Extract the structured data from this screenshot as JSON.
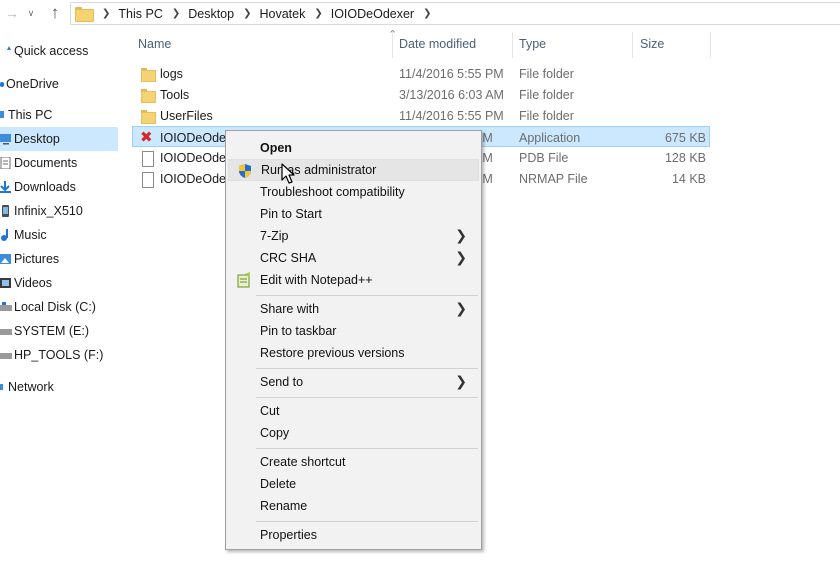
{
  "address": {
    "path": [
      "This PC",
      "Desktop",
      "Hovatek",
      "IOIODeOdexer"
    ]
  },
  "sidebar": {
    "items": [
      {
        "label": "Quick access",
        "icon": "star-icon"
      },
      {
        "label": "OneDrive",
        "icon": "cloud-icon"
      },
      {
        "label": "This PC",
        "icon": "computer-icon"
      },
      {
        "label": "Desktop",
        "icon": "desktop-icon",
        "selected": true
      },
      {
        "label": "Documents",
        "icon": "documents-icon"
      },
      {
        "label": "Downloads",
        "icon": "downloads-icon"
      },
      {
        "label": "Infinix_X510",
        "icon": "phone-icon"
      },
      {
        "label": "Music",
        "icon": "music-icon"
      },
      {
        "label": "Pictures",
        "icon": "pictures-icon"
      },
      {
        "label": "Videos",
        "icon": "videos-icon"
      },
      {
        "label": "Local Disk (C:)",
        "icon": "drive-icon"
      },
      {
        "label": "SYSTEM (E:)",
        "icon": "drive-icon"
      },
      {
        "label": "HP_TOOLS (F:)",
        "icon": "drive-icon"
      },
      {
        "label": "Network",
        "icon": "network-icon"
      }
    ]
  },
  "columns": {
    "name": "Name",
    "date": "Date modified",
    "type": "Type",
    "size": "Size"
  },
  "files": [
    {
      "name": "logs",
      "date": "11/4/2016 5:55 PM",
      "type": "File folder",
      "size": "",
      "icon": "folder-icon"
    },
    {
      "name": "Tools",
      "date": "3/13/2016 6:03 AM",
      "type": "File folder",
      "size": "",
      "icon": "folder-icon"
    },
    {
      "name": "UserFiles",
      "date": "11/4/2016 5:55 PM",
      "type": "File folder",
      "size": "",
      "icon": "folder-icon"
    },
    {
      "name": "IOIODeOdex",
      "date": "AM",
      "type": "Application",
      "size": "675 KB",
      "icon": "app-icon",
      "selected": true
    },
    {
      "name": "IOIODeOdex",
      "date": "AM",
      "type": "PDB File",
      "size": "128 KB",
      "icon": "file-icon"
    },
    {
      "name": "IOIODeOdex",
      "date": "AM",
      "type": "NRMAP File",
      "size": "14 KB",
      "icon": "file-icon"
    }
  ],
  "context_menu": {
    "items": {
      "open": "Open",
      "run_as_admin": "Run as administrator",
      "troubleshoot": "Troubleshoot compatibility",
      "pin_start": "Pin to Start",
      "seven_zip": "7-Zip",
      "crc_sha": "CRC SHA",
      "edit_notepad": "Edit with Notepad++",
      "share_with": "Share with",
      "pin_taskbar": "Pin to taskbar",
      "restore_versions": "Restore previous versions",
      "send_to": "Send to",
      "cut": "Cut",
      "copy": "Copy",
      "create_shortcut": "Create shortcut",
      "delete": "Delete",
      "rename": "Rename",
      "properties": "Properties"
    },
    "hovered": "Run as administrator"
  },
  "colors": {
    "selection": "#cce8ff",
    "selection_border": "#99d1ff",
    "menu_bg": "#f2f2f2",
    "menu_hover": "#e5e5e5"
  }
}
